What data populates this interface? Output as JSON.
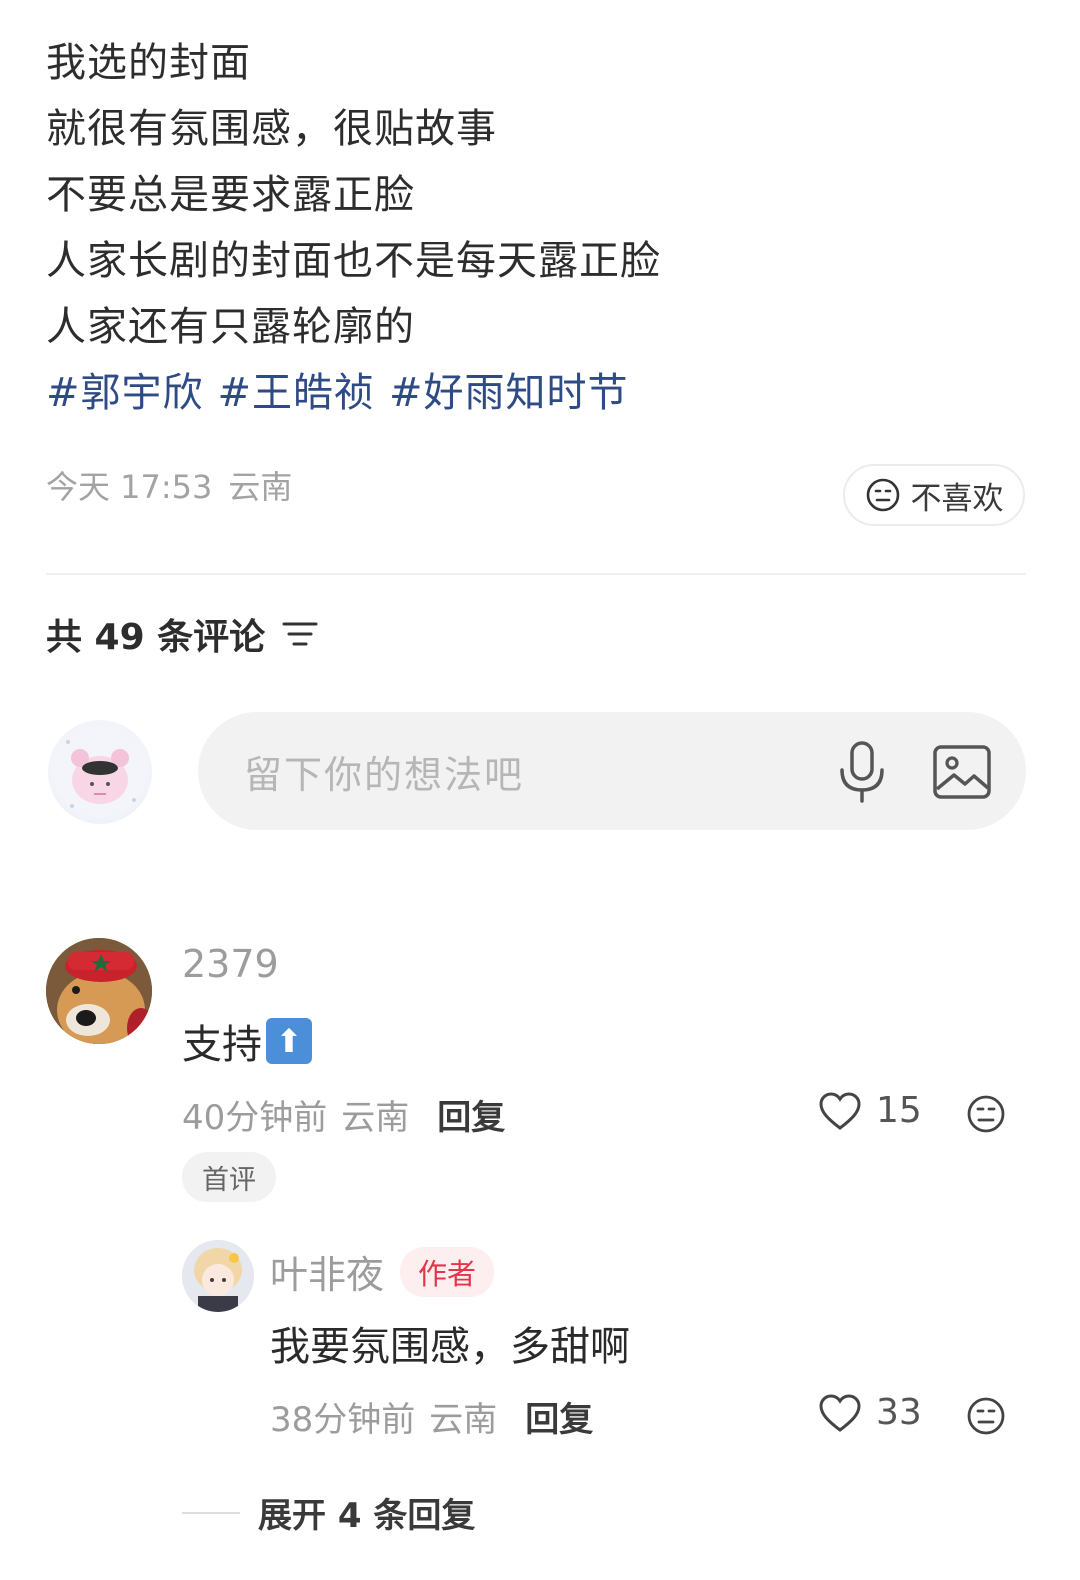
{
  "post": {
    "lines": [
      "我选的封面",
      "就很有氛围感，很贴故事",
      "不要总是要求露正脸",
      "人家长剧的封面也不是每天露正脸",
      "人家还有只露轮廓的"
    ],
    "tags": [
      "#郭宇欣",
      "#王皓祯",
      "#好雨知时节"
    ],
    "time": "今天 17:53",
    "location": "云南",
    "dislike_label": "不喜欢"
  },
  "comments_header": {
    "label": "共 49 条评论"
  },
  "comment_input": {
    "placeholder": "留下你的想法吧"
  },
  "comments": [
    {
      "username": "2379",
      "text": "支持",
      "emoji": "⬆",
      "time": "40分钟前",
      "location": "云南",
      "reply_label": "回复",
      "likes": "15",
      "badge": "首评"
    }
  ],
  "reply": {
    "username": "叶非夜",
    "author_badge": "作者",
    "text": "我要氛围感，多甜啊",
    "time": "38分钟前",
    "location": "云南",
    "reply_label": "回复",
    "likes": "33"
  },
  "expand_replies": {
    "label": "展开 4 条回复"
  },
  "colors": {
    "tag": "#2f4b86",
    "author_badge": "#e2374a",
    "muted": "#9c9c9c"
  }
}
